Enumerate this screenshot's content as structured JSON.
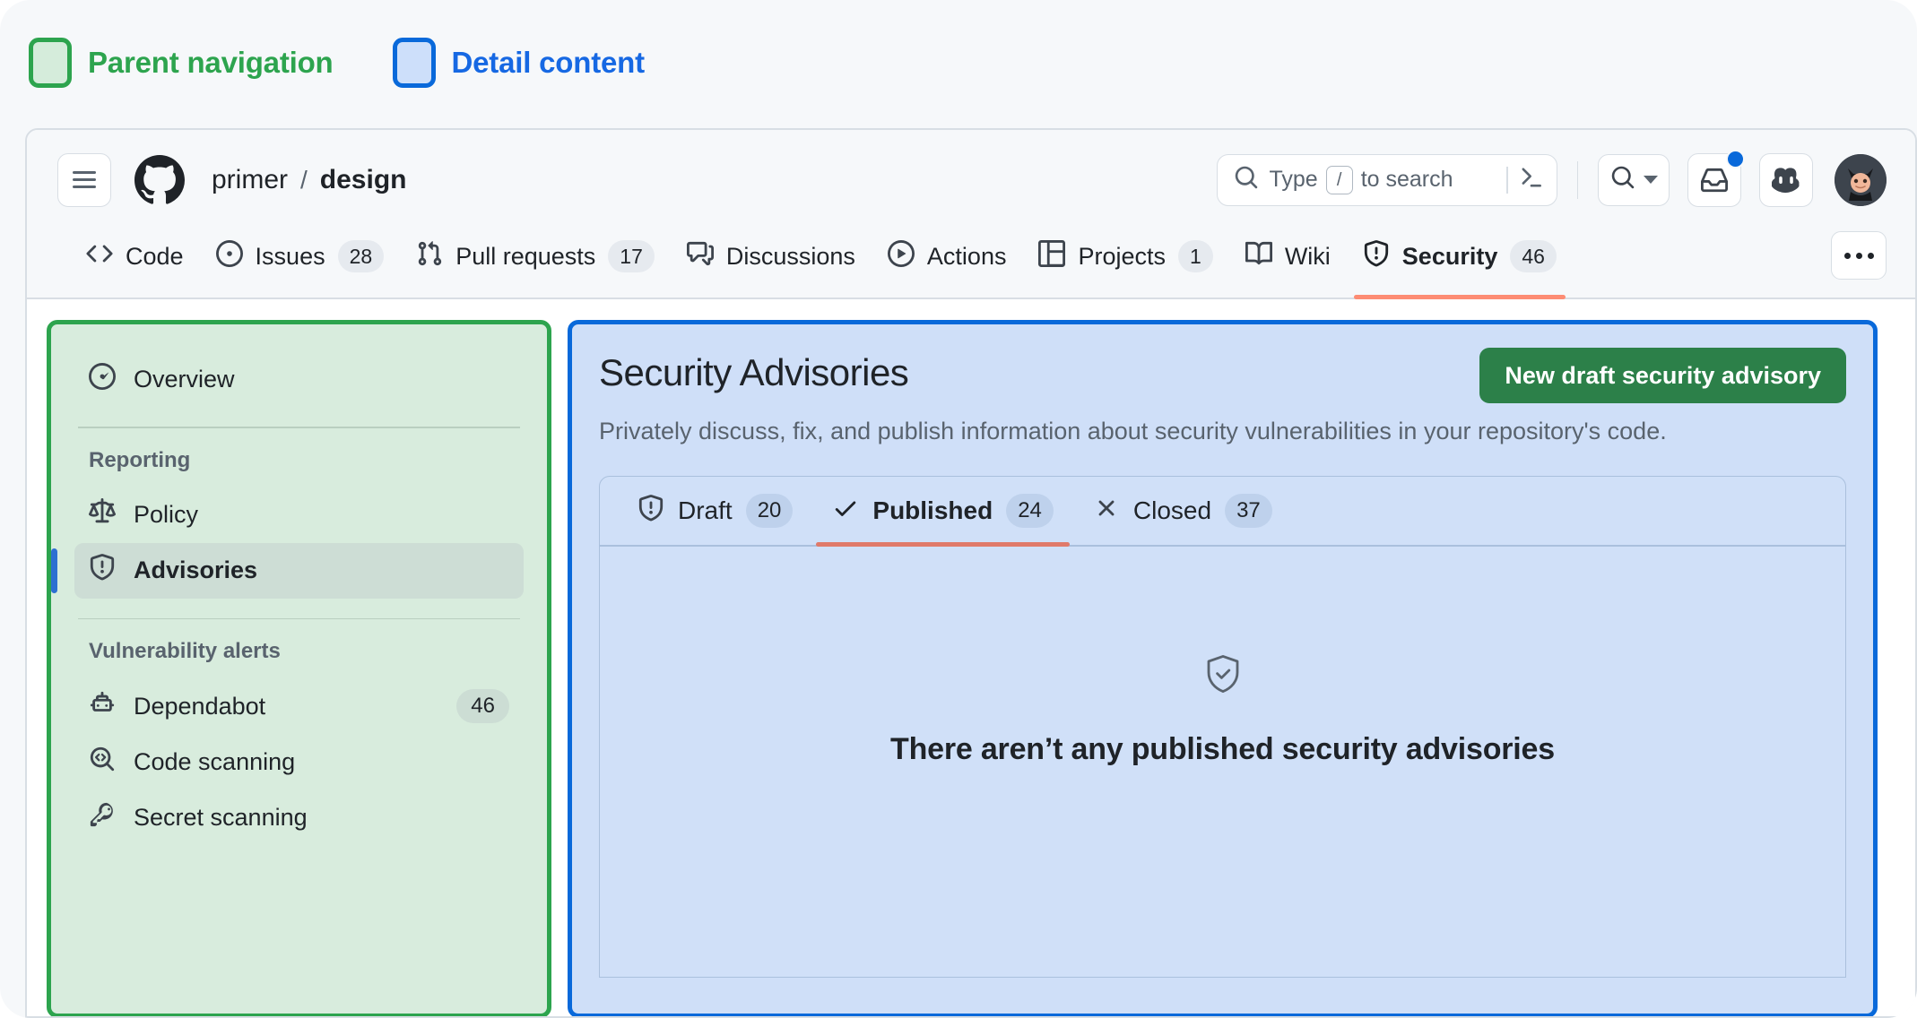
{
  "legend": {
    "items": [
      {
        "label": "Parent navigation",
        "color": "#2da44e"
      },
      {
        "label": "Detail content",
        "color": "#1668e3"
      }
    ]
  },
  "topbar": {
    "menu_icon": "hamburger-icon",
    "logo_icon": "github-logo-icon",
    "breadcrumb": {
      "owner": "primer",
      "separator": "/",
      "repo": "design"
    },
    "search": {
      "icon": "search-icon",
      "placeholder_before": "Type",
      "placeholder_key": "/",
      "placeholder_after": "to search",
      "terminal_icon": "command-palette-icon"
    },
    "search_dropdown_icon": "search-icon",
    "search_dropdown_caret": "chevron-down-icon",
    "inbox_icon": "inbox-icon",
    "inbox_has_notification": true,
    "copilot_icon": "copilot-icon",
    "avatar_icon": "user-avatar"
  },
  "repo_nav": {
    "tabs": [
      {
        "label": "Code",
        "icon": "code-icon",
        "count": "",
        "selected": false
      },
      {
        "label": "Issues",
        "icon": "issue-opened-icon",
        "count": "28",
        "selected": false
      },
      {
        "label": "Pull requests",
        "icon": "git-pull-request-icon",
        "count": "17",
        "selected": false
      },
      {
        "label": "Discussions",
        "icon": "comment-discussion-icon",
        "count": "",
        "selected": false
      },
      {
        "label": "Actions",
        "icon": "play-icon",
        "count": "",
        "selected": false
      },
      {
        "label": "Projects",
        "icon": "table-icon",
        "count": "1",
        "selected": false
      },
      {
        "label": "Wiki",
        "icon": "book-icon",
        "count": "",
        "selected": false
      },
      {
        "label": "Security",
        "icon": "shield-alert-icon",
        "count": "46",
        "selected": true
      }
    ],
    "overflow_label": "More",
    "selected_underline_color": "#fd8c73"
  },
  "sidebar": {
    "top_items": [
      {
        "label": "Overview",
        "icon": "meter-icon",
        "count": "",
        "active": false
      }
    ],
    "sections": [
      {
        "title": "Reporting",
        "items": [
          {
            "label": "Policy",
            "icon": "law-icon",
            "count": "",
            "active": false
          },
          {
            "label": "Advisories",
            "icon": "shield-alert-icon",
            "count": "",
            "active": true
          }
        ]
      },
      {
        "title": "Vulnerability alerts",
        "items": [
          {
            "label": "Dependabot",
            "icon": "dependabot-icon",
            "count": "46",
            "active": false
          },
          {
            "label": "Code scanning",
            "icon": "code-search-icon",
            "count": "",
            "active": false
          },
          {
            "label": "Secret scanning",
            "icon": "key-icon",
            "count": "",
            "active": false
          }
        ]
      }
    ]
  },
  "main": {
    "title": "Security Advisories",
    "action_button": "New draft security advisory",
    "description": "Privately discuss, fix, and publish information about security vulnerabilities in your repository's code.",
    "tabs": [
      {
        "label": "Draft",
        "icon": "shield-alert-icon",
        "count": "20",
        "selected": false
      },
      {
        "label": "Published",
        "icon": "check-icon",
        "count": "24",
        "selected": true
      },
      {
        "label": "Closed",
        "icon": "x-icon",
        "count": "37",
        "selected": false
      }
    ],
    "empty_state": {
      "icon": "shield-check-icon",
      "title": "There aren’t any published security advisories"
    }
  },
  "colors": {
    "parent_outline": "#2da44e",
    "parent_fill": "#d8ecdd",
    "detail_outline": "#0969da",
    "detail_fill": "#cfdff8",
    "accent_green": "#2c8049",
    "tab_underline": "#fd8c73",
    "notification": "#0969da"
  }
}
